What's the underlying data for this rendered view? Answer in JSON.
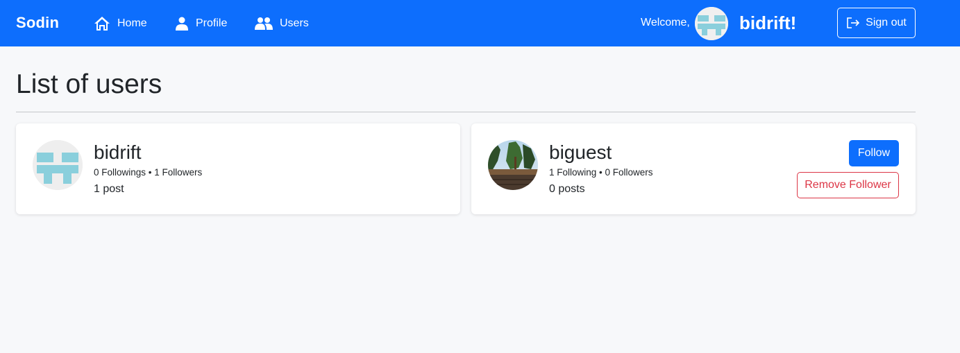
{
  "navbar": {
    "brand": "Sodin",
    "links": [
      {
        "label": "Home",
        "icon": "home-icon"
      },
      {
        "label": "Profile",
        "icon": "person-icon"
      },
      {
        "label": "Users",
        "icon": "people-icon"
      }
    ],
    "welcome": "Welcome,",
    "username": "bidrift!",
    "signout_label": "Sign out",
    "signout_icon": "sign-out-icon",
    "color": "#0d6efd"
  },
  "main": {
    "title": "List of users",
    "users": [
      {
        "name": "bidrift",
        "stats": "0 Followings • 1 Followers",
        "posts": "1 post",
        "avatar": "identicon-avatar"
      },
      {
        "name": "biguest",
        "stats": "1 Following • 0 Followers",
        "posts": "0 posts",
        "avatar": "photo-avatar",
        "follow_label": "Follow",
        "remove_label": "Remove Follower"
      }
    ]
  },
  "colors": {
    "primary": "#0d6efd",
    "danger": "#dc3545",
    "background": "#f7f8fa"
  }
}
